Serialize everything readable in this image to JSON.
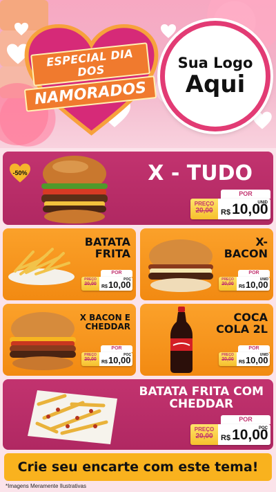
{
  "hero": {
    "title_line1": "ESPECIAL DIA DOS",
    "title_line2": "NAMORADOS",
    "logo_line1": "Sua Logo",
    "logo_line2": "Aqui"
  },
  "price_labels": {
    "preco": "PREÇO",
    "por": "POR",
    "currency": "R$",
    "unid": "UNID",
    "poc": "POÇ"
  },
  "products": [
    {
      "name": "X - TUDO",
      "badge": "-50%",
      "old_price": "20,00",
      "price": "10,00",
      "unit": "UNID"
    },
    {
      "name_line1": "BATATA",
      "name_line2": "FRITA",
      "old_price": "20,00",
      "price": "10,00",
      "unit": "POÇ"
    },
    {
      "name_line1": "X-",
      "name_line2": "BACON",
      "old_price": "20,00",
      "price": "10,00",
      "unit": "UNID"
    },
    {
      "name_line1": "X BACON E",
      "name_line2": "CHEDDAR",
      "old_price": "20,00",
      "price": "10,00",
      "unit": "POÇ"
    },
    {
      "name_line1": "COCA",
      "name_line2": "COLA 2L",
      "old_price": "20,00",
      "price": "10,00",
      "unit": "UNID"
    },
    {
      "name_line1": "BATATA FRITA COM",
      "name_line2": "CHEDDAR",
      "old_price": "20,00",
      "price": "10,00",
      "unit": "POÇ"
    }
  ],
  "banner": "Crie seu encarte com este tema!",
  "footnote": "*Imagens Meramente Ilustrativas",
  "colors": {
    "pink": "#c2336f",
    "orange": "#f7951c",
    "yellow": "#f9b21e"
  }
}
